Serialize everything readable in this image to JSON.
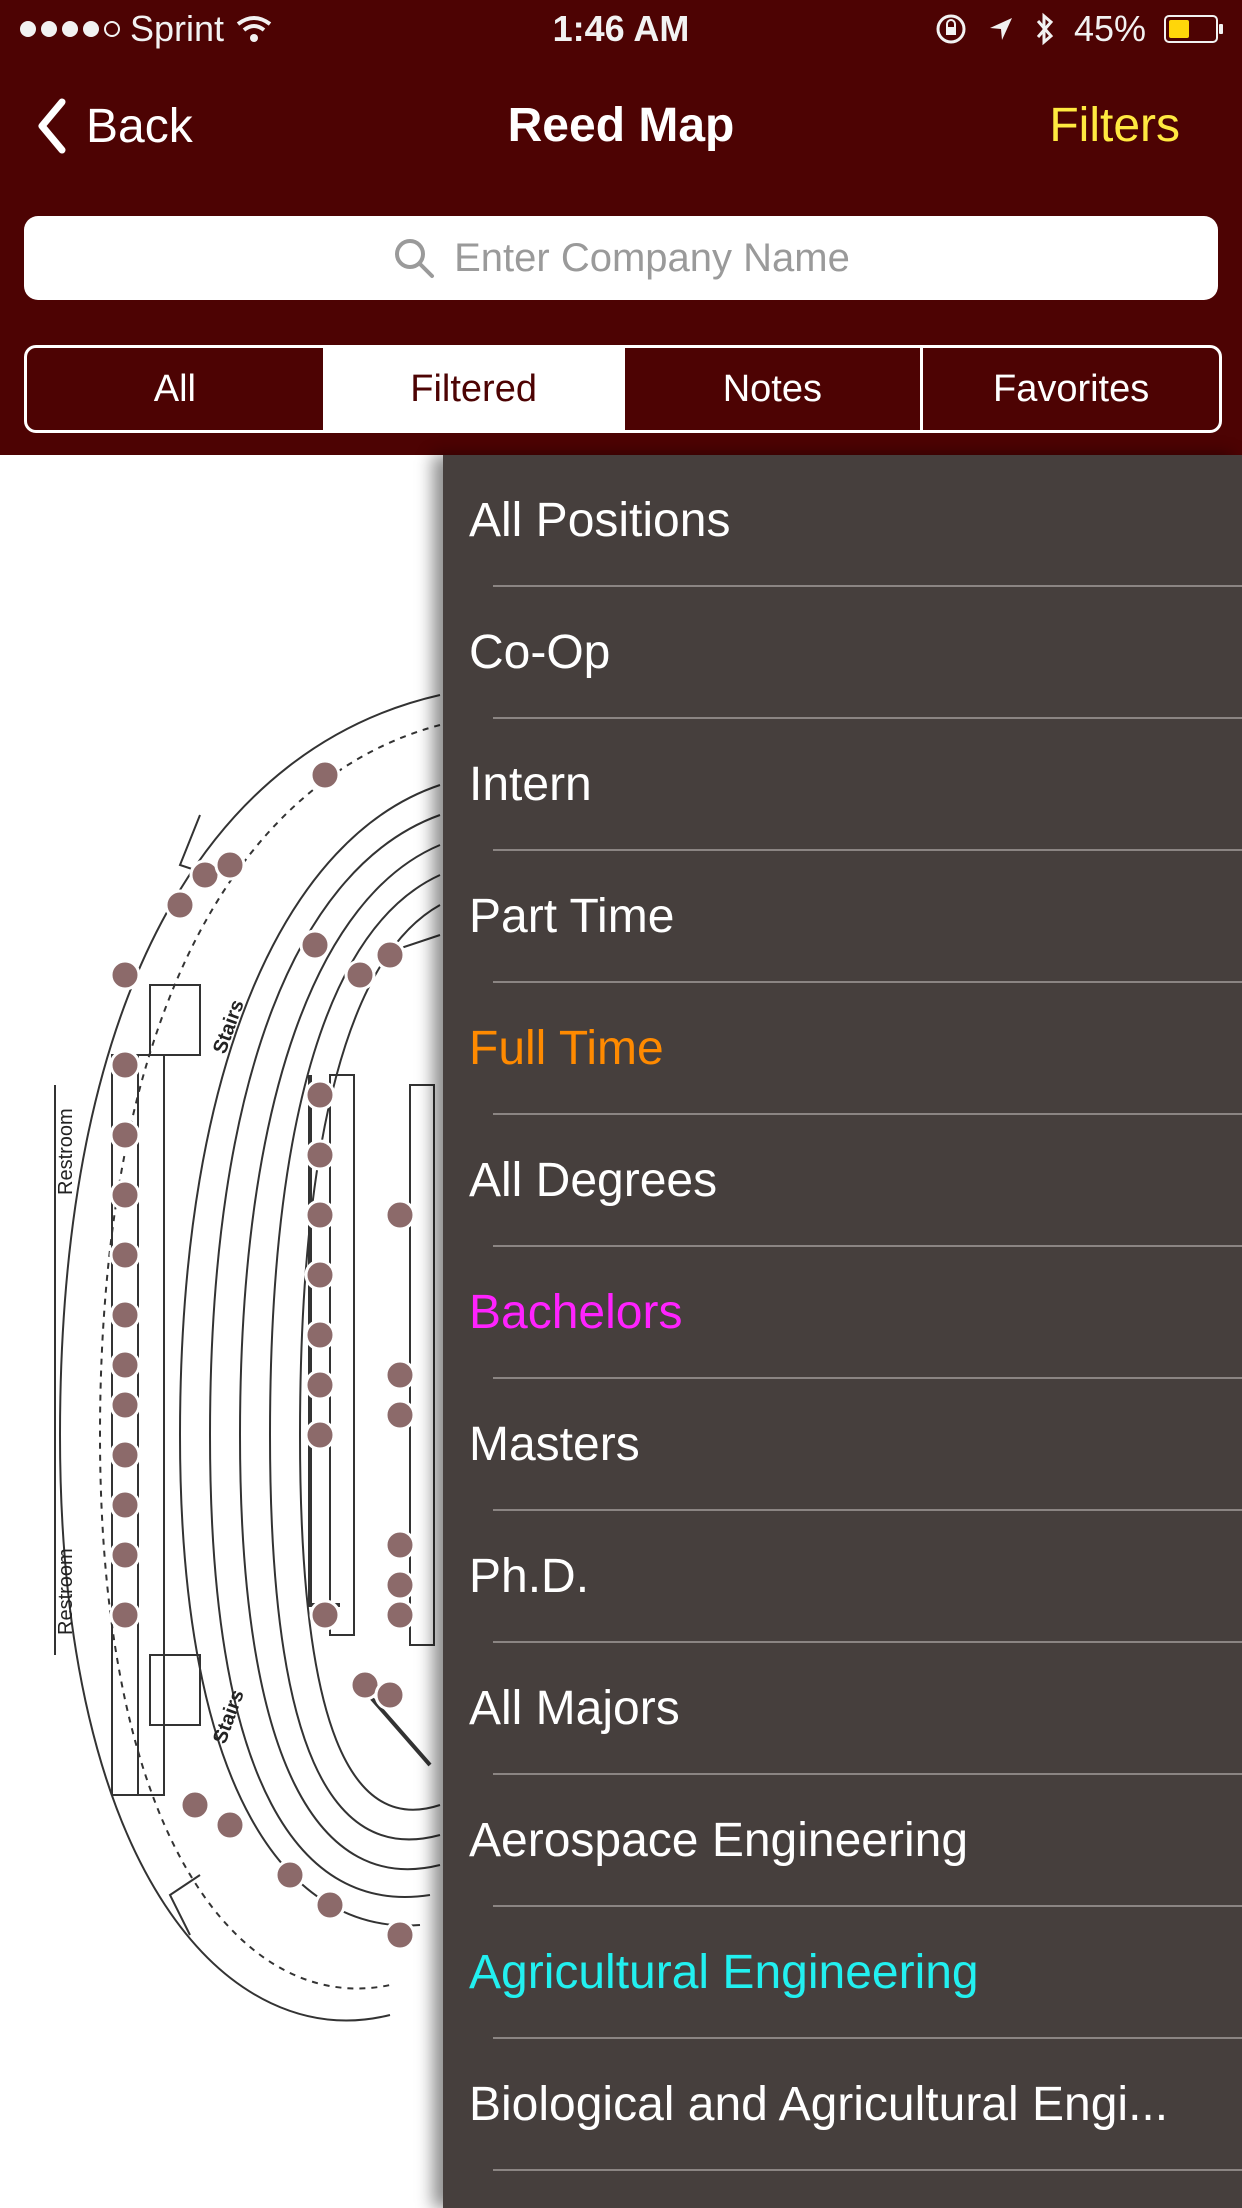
{
  "status_bar": {
    "carrier": "Sprint",
    "time": "1:46 AM",
    "battery": "45%",
    "battery_level": 0.45,
    "battery_color": "#ffd60a"
  },
  "nav": {
    "back_label": "Back",
    "title": "Reed Map",
    "filters_label": "Filters",
    "filters_color": "#ffe940",
    "bar_color": "#4d0303"
  },
  "search": {
    "placeholder": "Enter Company Name"
  },
  "segments": [
    {
      "label": "All",
      "selected": false
    },
    {
      "label": "Filtered",
      "selected": true
    },
    {
      "label": "Notes",
      "selected": false
    },
    {
      "label": "Favorites",
      "selected": false
    }
  ],
  "map": {
    "labels": [
      "Restroom",
      "Restroom",
      "Stairs",
      "Stairs"
    ]
  },
  "menu": {
    "items": [
      {
        "label": "All Positions",
        "color": "#ffffff"
      },
      {
        "label": "Co-Op",
        "color": "#ffffff"
      },
      {
        "label": "Intern",
        "color": "#ffffff"
      },
      {
        "label": "Part Time",
        "color": "#ffffff"
      },
      {
        "label": "Full Time",
        "color": "#ff8a00"
      },
      {
        "label": "All Degrees",
        "color": "#ffffff"
      },
      {
        "label": "Bachelors",
        "color": "#ff22ff"
      },
      {
        "label": "Masters",
        "color": "#ffffff"
      },
      {
        "label": "Ph.D.",
        "color": "#ffffff"
      },
      {
        "label": "All Majors",
        "color": "#ffffff"
      },
      {
        "label": "Aerospace Engineering",
        "color": "#ffffff"
      },
      {
        "label": "Agricultural Engineering",
        "color": "#22f0f0"
      },
      {
        "label": "Biological and Agricultural Engi...",
        "color": "#ffffff"
      }
    ]
  }
}
